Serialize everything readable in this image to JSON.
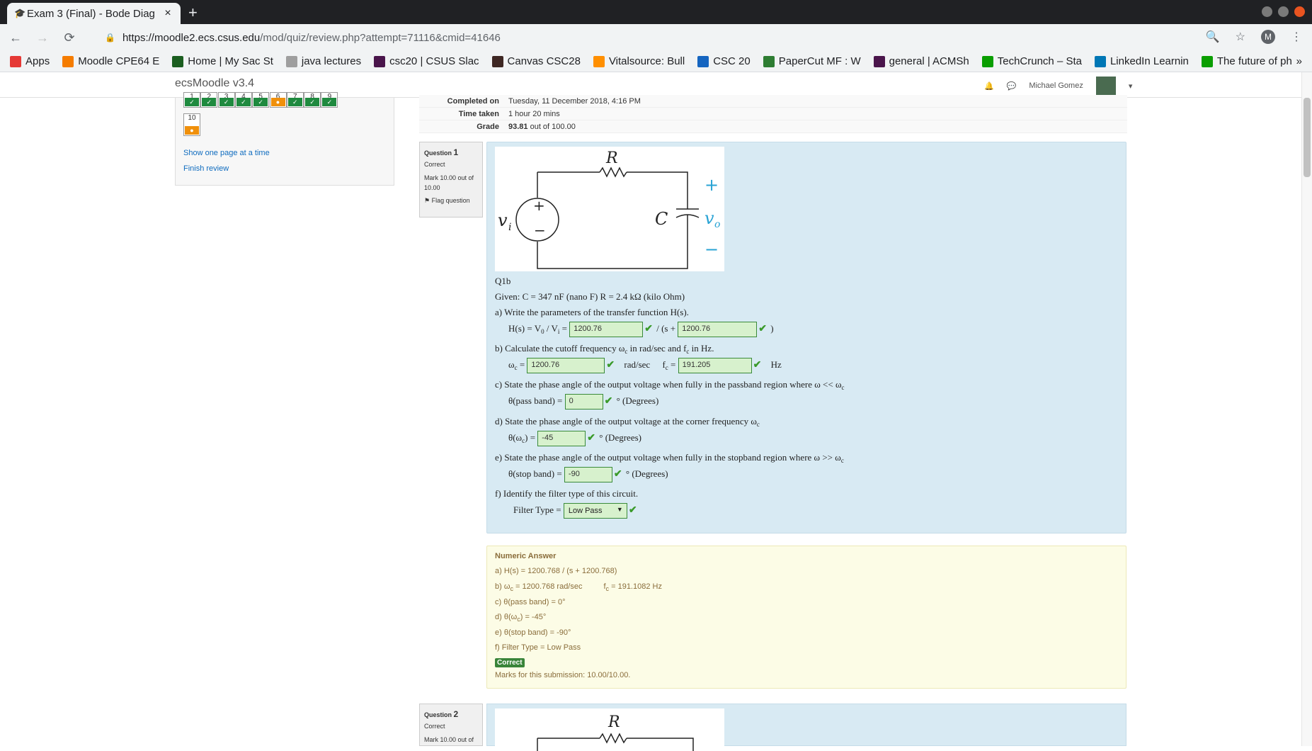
{
  "browser": {
    "tab_title": "Exam 3 (Final) - Bode Diag",
    "url_host": "https://moodle2.ecs.csus.edu",
    "url_path": "/mod/quiz/review.php?attempt=71116&cmid=41646",
    "account_initial": "M",
    "bookmarks": [
      {
        "label": "Apps",
        "color": "#e53935"
      },
      {
        "label": "Moodle CPE64 E",
        "color": "#f57c00"
      },
      {
        "label": "Home | My Sac St",
        "color": "#1b5e20"
      },
      {
        "label": "java lectures",
        "color": "#9e9e9e"
      },
      {
        "label": "csc20 | CSUS Slac",
        "color": "#4a154b"
      },
      {
        "label": "Canvas CSC28",
        "color": "#3e2723"
      },
      {
        "label": "Vitalsource: Bull",
        "color": "#ff8f00"
      },
      {
        "label": "CSC 20",
        "color": "#1565c0"
      },
      {
        "label": "PaperCut MF : W",
        "color": "#2e7d32"
      },
      {
        "label": "general | ACMSh",
        "color": "#4a154b"
      },
      {
        "label": "TechCrunch – Sta",
        "color": "#0a9e01"
      },
      {
        "label": "LinkedIn Learnin",
        "color": "#0077b5"
      },
      {
        "label": "The future of ph",
        "color": "#0a9e01"
      }
    ],
    "bookmarks_more": "»"
  },
  "site": {
    "brand": "ecsMoodle v3.4",
    "user_name": "Michael Gomez"
  },
  "quiz_nav": {
    "numbers": [
      "1",
      "2",
      "3",
      "4",
      "5",
      "6",
      "7",
      "8",
      "9",
      "10"
    ],
    "show_one_page": "Show one page at a time",
    "finish_review": "Finish review"
  },
  "summary": {
    "rows": [
      {
        "k": "Completed on",
        "v": "Tuesday, 11 December 2018, 4:16 PM"
      },
      {
        "k": "Time taken",
        "v": "1 hour 20 mins"
      },
      {
        "k": "Grade",
        "v_bold": "93.81",
        "v": " out of 100.00"
      }
    ]
  },
  "question1": {
    "label": "Question",
    "number": "1",
    "state": "Correct",
    "mark": "Mark 10.00 out of 10.00",
    "flag": "Flag question",
    "circuit": {
      "R": "R",
      "C": "C",
      "vi": "v",
      "vi_sub": "i",
      "vo": "v",
      "vo_sub": "o",
      "plus": "+",
      "minus": "−"
    },
    "code": "Q1b",
    "given": "Given: C = 347 nF (nano F)   R = 2.4 kΩ (kilo Ohm)",
    "a_text": "a)  Write the parameters of the transfer function H(s).",
    "a_hs": "H(s) = V",
    "a_hs_sub0": "0",
    "a_hs_mid": " / V",
    "a_hs_subi": "i",
    "a_hs_eq": " = ",
    "a_val1": "1200.76",
    "a_mid": " / (s + ",
    "a_val2": "1200.76",
    "a_end": " )",
    "b_text": "b)  Calculate the cutoff frequency ω",
    "b_text_sub": "c",
    "b_text_rest": " in rad/sec and f",
    "b_text_sub2": "c",
    "b_text_end": " in Hz.",
    "b_wc": "ω",
    "b_wc_sub": "c",
    "b_eq": " = ",
    "b_val1": "1200.76",
    "b_unit1": "rad/sec",
    "b_fc": "f",
    "b_fc_sub": "c",
    "b_val2": "191.205",
    "b_unit2": "Hz",
    "c_text": "c)  State the phase angle of the output voltage when fully in the passband region where ω << ω",
    "c_text_sub": "c",
    "c_label": "θ(pass band) = ",
    "c_val": "0",
    "c_unit": "° (Degrees)",
    "d_text": "d)  State the phase angle of the output voltage at the corner frequency ω",
    "d_text_sub": "c",
    "d_label": "θ(ω",
    "d_label_sub": "c",
    "d_label_end": ") = ",
    "d_val": "-45",
    "d_unit": "° (Degrees)",
    "e_text": "e)  State the phase angle of the output voltage when fully in the stopband region where ω >> ω",
    "e_text_sub": "c",
    "e_label": "θ(stop band) = ",
    "e_val": "-90",
    "e_unit": "° (Degrees)",
    "f_text": "f)  Identify the filter type of this circuit.",
    "f_label": "Filter Type = ",
    "f_val": "Low Pass"
  },
  "feedback": {
    "head": "Numeric Answer",
    "a": "a)  H(s) = 1200.768 / (s + 1200.768)",
    "b1": "b)  ω",
    "b1_sub": "c",
    "b1_rest": " = 1200.768 rad/sec",
    "b2": "f",
    "b2_sub": "c",
    "b2_rest": " = 191.1082 Hz",
    "c": "c)  θ(pass band) = 0°",
    "d": "d)  θ(ω",
    "d_sub": "c",
    "d_rest": ") = -45°",
    "e": "e)  θ(stop band) = -90°",
    "f": "f)   Filter Type = Low Pass",
    "badge": "Correct",
    "marks": "Marks for this submission: 10.00/10.00."
  },
  "question2": {
    "label": "Question",
    "number": "2",
    "state": "Correct",
    "mark": "Mark 10.00 out of",
    "circuit_R": "R"
  }
}
